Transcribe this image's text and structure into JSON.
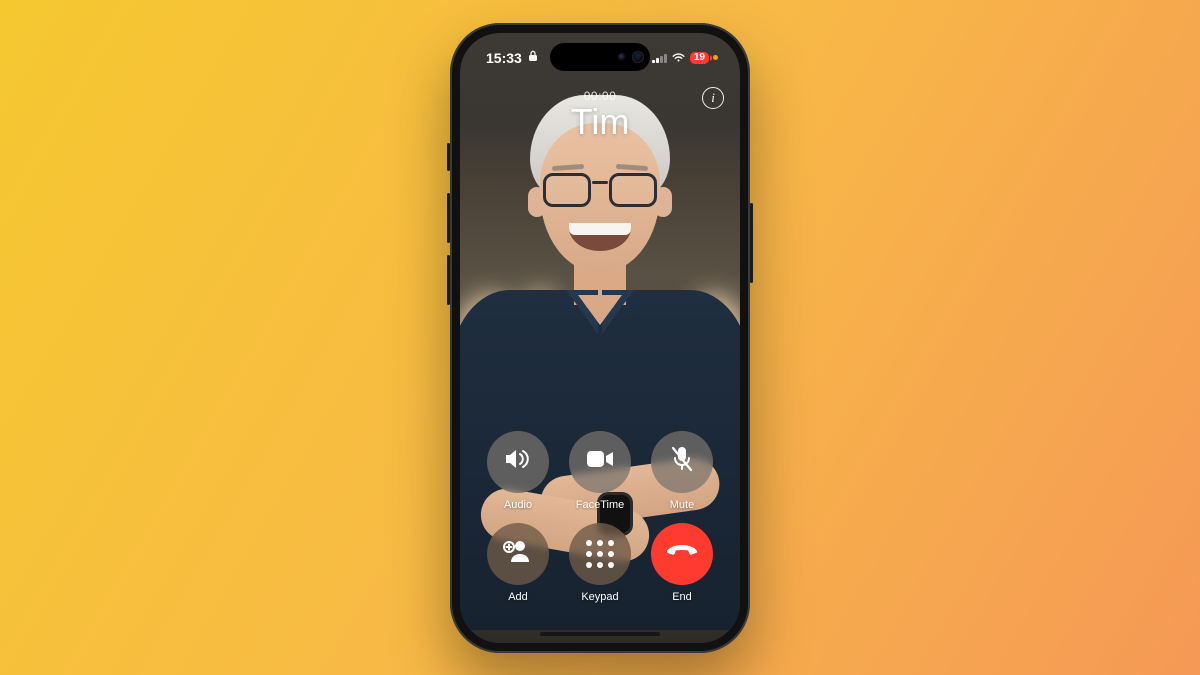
{
  "status_bar": {
    "time": "15:33",
    "battery_percent": "19",
    "locked": true
  },
  "call": {
    "duration": "00:00",
    "caller_name": "Tim"
  },
  "info_button_glyph": "i",
  "controls": {
    "audio": {
      "label": "Audio"
    },
    "facetime": {
      "label": "FaceTime"
    },
    "mute": {
      "label": "Mute"
    },
    "add": {
      "label": "Add"
    },
    "keypad": {
      "label": "Keypad"
    },
    "end": {
      "label": "End"
    }
  },
  "colors": {
    "end_call": "#ff3b30",
    "battery_low": "#ff3b30",
    "recording_indicator": "#ff9f0a"
  }
}
